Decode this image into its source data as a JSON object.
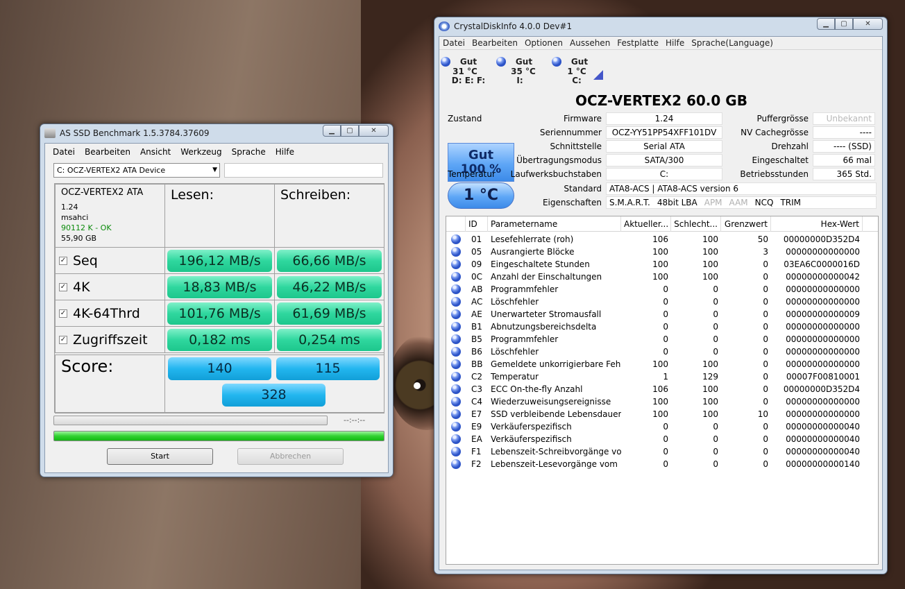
{
  "asssd": {
    "title": "AS SSD Benchmark 1.5.3784.37609",
    "menu": [
      "Datei",
      "Bearbeiten",
      "Ansicht",
      "Werkzeug",
      "Sprache",
      "Hilfe"
    ],
    "device": "C: OCZ-VERTEX2 ATA Device",
    "drive": {
      "name": "OCZ-VERTEX2 ATA",
      "firmware": "1.24",
      "driver": "msahci",
      "align": "90112 K - OK",
      "size": "55,90 GB"
    },
    "read_label": "Lesen:",
    "write_label": "Schreiben:",
    "rows": [
      {
        "label": "Seq",
        "read": "196,12 MB/s",
        "write": "66,66 MB/s"
      },
      {
        "label": "4K",
        "read": "18,83 MB/s",
        "write": "46,22 MB/s"
      },
      {
        "label": "4K-64Thrd",
        "read": "101,76 MB/s",
        "write": "61,69 MB/s"
      },
      {
        "label": "Zugriffszeit",
        "read": "0,182 ms",
        "write": "0,254 ms"
      }
    ],
    "score_label": "Score:",
    "score_read": "140",
    "score_write": "115",
    "score_total": "328",
    "time": "--:--:--",
    "start": "Start",
    "cancel": "Abbrechen",
    "progress_top": 0,
    "progress_bottom": 1
  },
  "cdi": {
    "title": "CrystalDiskInfo 4.0.0 Dev#1",
    "menu": [
      "Datei",
      "Bearbeiten",
      "Optionen",
      "Aussehen",
      "Festplatte",
      "Hilfe",
      "Sprache(Language)"
    ],
    "drives": [
      {
        "status": "Gut",
        "temp": "31 °C",
        "letters": "D: E: F:"
      },
      {
        "status": "Gut",
        "temp": "35 °C",
        "letters": "I:"
      },
      {
        "status": "Gut",
        "temp": "1 °C",
        "letters": "C:"
      }
    ],
    "model": "OCZ-VERTEX2  60.0 GB",
    "health_label": "Zustand",
    "health_status": "Gut",
    "health_pct": "100 %",
    "temp_label": "Temperatur",
    "temp": "1 °C",
    "fields": {
      "firmware_l": "Firmware",
      "firmware": "1.24",
      "serial_l": "Seriennummer",
      "serial": "OCZ-YY51PP54XFF101DV",
      "iface_l": "Schnittstelle",
      "iface": "Serial ATA",
      "mode_l": "Übertragungsmodus",
      "mode": "SATA/300",
      "letters_l": "Laufwerksbuchstaben",
      "letters": "C:",
      "buffer_l": "Puffergrösse",
      "buffer": "Unbekannt",
      "nvcache_l": "NV Cachegrösse",
      "nvcache": "----",
      "rpm_l": "Drehzahl",
      "rpm": "---- (SSD)",
      "count_l": "Eingeschaltet",
      "count": "66 mal",
      "hours_l": "Betriebsstunden",
      "hours": "365 Std.",
      "standard_l": "Standard",
      "standard": "ATA8-ACS | ATA8-ACS version 6",
      "features_l": "Eigenschaften"
    },
    "features": [
      "S.M.A.R.T.",
      "48bit LBA",
      "APM",
      "AAM",
      "NCQ",
      "TRIM"
    ],
    "headers": [
      "ID",
      "Parametername",
      "Aktueller...",
      "Schlecht...",
      "Grenzwert",
      "Hex-Wert"
    ],
    "rows": [
      [
        "01",
        "Lesefehlerrate (roh)",
        "106",
        "100",
        "50",
        "00000000D352D4"
      ],
      [
        "05",
        "Ausrangierte Blöcke",
        "100",
        "100",
        "3",
        "00000000000000"
      ],
      [
        "09",
        "Eingeschaltete Stunden",
        "100",
        "100",
        "0",
        "03EA6C0000016D"
      ],
      [
        "0C",
        "Anzahl der Einschaltungen",
        "100",
        "100",
        "0",
        "00000000000042"
      ],
      [
        "AB",
        "Programmfehler",
        "0",
        "0",
        "0",
        "00000000000000"
      ],
      [
        "AC",
        "Löschfehler",
        "0",
        "0",
        "0",
        "00000000000000"
      ],
      [
        "AE",
        "Unerwarteter Stromausfall",
        "0",
        "0",
        "0",
        "00000000000009"
      ],
      [
        "B1",
        "Abnutzungsbereichsdelta",
        "0",
        "0",
        "0",
        "00000000000000"
      ],
      [
        "B5",
        "Programmfehler",
        "0",
        "0",
        "0",
        "00000000000000"
      ],
      [
        "B6",
        "Löschfehler",
        "0",
        "0",
        "0",
        "00000000000000"
      ],
      [
        "BB",
        "Gemeldete unkorrigierbare Fehler",
        "100",
        "100",
        "0",
        "00000000000000"
      ],
      [
        "C2",
        "Temperatur",
        "1",
        "129",
        "0",
        "00007F00810001"
      ],
      [
        "C3",
        "ECC On-the-fly Anzahl",
        "106",
        "100",
        "0",
        "00000000D352D4"
      ],
      [
        "C4",
        "Wiederzuweisungsereignisse",
        "100",
        "100",
        "0",
        "00000000000000"
      ],
      [
        "E7",
        "SSD verbleibende Lebensdauer",
        "100",
        "100",
        "10",
        "00000000000000"
      ],
      [
        "E9",
        "Verkäuferspezifisch",
        "0",
        "0",
        "0",
        "00000000000040"
      ],
      [
        "EA",
        "Verkäuferspezifisch",
        "0",
        "0",
        "0",
        "00000000000040"
      ],
      [
        "F1",
        "Lebenszeit-Schreibvorgänge vo...",
        "0",
        "0",
        "0",
        "00000000000040"
      ],
      [
        "F2",
        "Lebenszeit-Lesevorgänge vom ...",
        "0",
        "0",
        "0",
        "00000000000140"
      ]
    ]
  }
}
